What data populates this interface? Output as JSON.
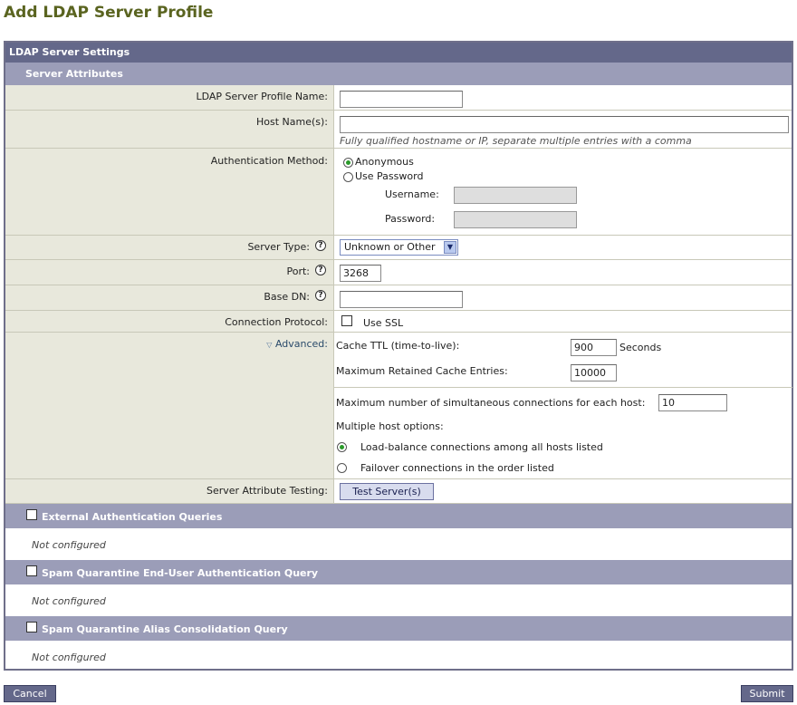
{
  "page": {
    "title": "Add LDAP Server Profile"
  },
  "panel": {
    "header": "LDAP Server Settings",
    "subheader": "Server Attributes"
  },
  "fields": {
    "profile_name": {
      "label": "LDAP Server Profile Name:",
      "value": ""
    },
    "host_names": {
      "label": "Host Name(s):",
      "value": "",
      "hint": "Fully qualified hostname or IP, separate multiple entries with a comma"
    },
    "auth_method": {
      "label": "Authentication Method:",
      "options": [
        "Anonymous",
        "Use Password"
      ],
      "selected": "Anonymous",
      "username_label": "Username:",
      "password_label": "Password:",
      "username_value": "",
      "password_value": ""
    },
    "server_type": {
      "label": "Server Type:",
      "value": "Unknown or Other"
    },
    "port": {
      "label": "Port:",
      "value": "3268"
    },
    "base_dn": {
      "label": "Base DN:",
      "value": ""
    },
    "connection_protocol": {
      "label": "Connection Protocol:",
      "option": "Use SSL",
      "checked": false
    },
    "advanced": {
      "label": "Advanced:",
      "cache_ttl_label": "Cache TTL (time-to-live):",
      "cache_ttl_value": "900",
      "cache_ttl_unit": "Seconds",
      "max_cache_label": "Maximum Retained Cache Entries:",
      "max_cache_value": "10000",
      "max_conn_label": "Maximum number of simultaneous connections for each host:",
      "max_conn_value": "10",
      "multi_host_label": "Multiple host options:",
      "multi_host_options": [
        "Load-balance connections among all hosts listed",
        "Failover connections in the order listed"
      ],
      "multi_host_selected": "Load-balance connections among all hosts listed"
    },
    "testing": {
      "label": "Server Attribute Testing:",
      "button": "Test Server(s)"
    }
  },
  "sections": [
    {
      "title": "External Authentication Queries",
      "status": "Not configured",
      "checked": false
    },
    {
      "title": "Spam Quarantine End-User Authentication Query",
      "status": "Not configured",
      "checked": false
    },
    {
      "title": "Spam Quarantine Alias Consolidation Query",
      "status": "Not configured",
      "checked": false
    }
  ],
  "footer": {
    "cancel": "Cancel",
    "submit": "Submit"
  },
  "colors": {
    "title": "#5a6420",
    "header": "#64688a",
    "subheader": "#9b9db8",
    "label_bg": "#e8e8dc",
    "radio_on": "#2a9a2a"
  }
}
